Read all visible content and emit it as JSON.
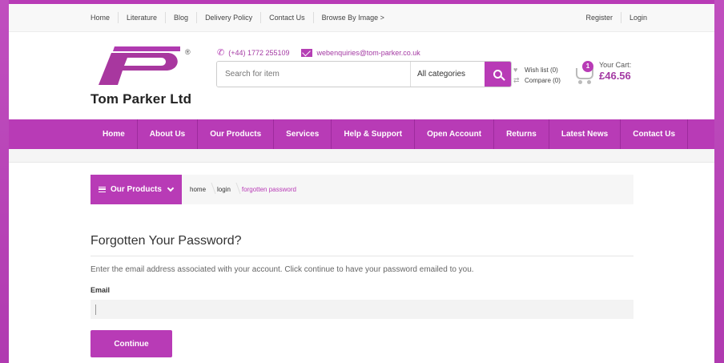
{
  "topbar": {
    "links": [
      "Home",
      "Literature",
      "Blog",
      "Delivery Policy",
      "Contact Us",
      "Browse By Image >"
    ],
    "account": [
      "Register",
      "Login"
    ]
  },
  "header": {
    "logo_text": "Tom Parker Ltd",
    "logo_reg": "®",
    "phone": "(+44) 1772 255109",
    "email": "webenquiries@tom-parker.co.uk",
    "search_placeholder": "Search for item",
    "category": "All categories",
    "wishlist": "Wish list (0)",
    "compare": "Compare (0)",
    "cart_count": "1",
    "cart_label": "Your Cart:",
    "cart_total": "£46.56"
  },
  "nav": {
    "items": [
      "Home",
      "About Us",
      "Our Products",
      "Services",
      "Help & Support",
      "Open Account",
      "Returns",
      "Latest News",
      "Contact Us"
    ]
  },
  "breadcrumb": {
    "menu_label": "Our Products",
    "crumbs": [
      "home",
      "login",
      "forgotten password"
    ]
  },
  "content": {
    "title": "Forgotten Your Password?",
    "description": "Enter the email address associated with your account. Click continue to have your password emailed to you.",
    "email_label": "Email",
    "email_value": "",
    "continue_label": "Continue"
  },
  "colors": {
    "brand": "#b83bb6",
    "frame": "#b03ab0"
  }
}
